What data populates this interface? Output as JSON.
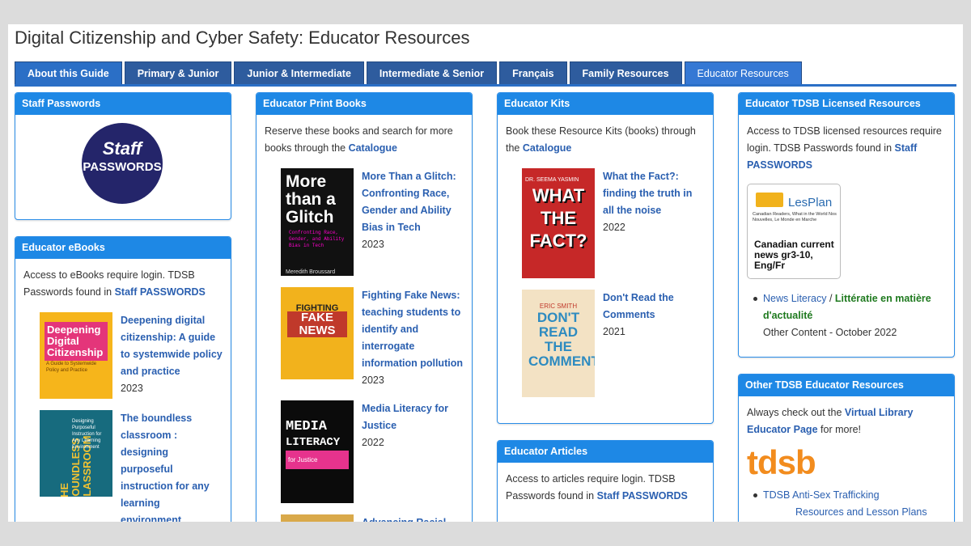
{
  "page_title": "Digital Citizenship and Cyber Safety: Educator Resources",
  "tabs": [
    "About this Guide",
    "Primary & Junior",
    "Junior & Intermediate",
    "Intermediate & Senior",
    "Français",
    "Family Resources",
    "Educator Resources"
  ],
  "staff_passwords": {
    "heading": "Staff Passwords",
    "logo_line1": "Staff",
    "logo_line2": "PASSWORDS"
  },
  "ebooks": {
    "heading": "Educator eBooks",
    "intro": "Access to eBooks require login. TDSB Passwords found in",
    "intro_link": "Staff PASSWORDS",
    "books": [
      {
        "title": "Deepening digital citizenship: A guide to systemwide policy and practice",
        "year": "2023",
        "cover": "Deepening Digital Citizenship",
        "cover_sub": "A Guide to Systemwide Policy and Practice"
      },
      {
        "title": "The boundless classroom : designing purposeful instruction for any learning environment",
        "year": "2023",
        "cover": "THE BOUNDLESS CLASSROOM",
        "cover_sub": "Designing Purposeful Instruction for Any Learning Environment"
      }
    ]
  },
  "print_books": {
    "heading": "Educator Print Books",
    "intro": "Reserve these books and search for more books through the",
    "intro_link": "Catalogue",
    "books": [
      {
        "title": "More Than a Glitch: Confronting Race, Gender and Ability Bias in Tech",
        "year": "2023",
        "cover": "More than a Glitch",
        "cover_sub": "Confronting Race, Gender, and Ability Bias in Tech",
        "author": "Meredith Broussard"
      },
      {
        "title": "Fighting Fake News: teaching students to identify and interrogate information pollution",
        "year": "2023",
        "cover_l1": "FIGHTING",
        "cover_l2": "FAKE NEWS"
      },
      {
        "title": "Media Literacy for Justice",
        "year": "2022",
        "cover_l1": "MEDIA",
        "cover_l2": "LITERACY",
        "cover_l3": "for Justice"
      },
      {
        "title": "Advancing Racial"
      }
    ]
  },
  "kits": {
    "heading": "Educator Kits",
    "intro": "Book these Resource Kits (books) through the",
    "intro_link": "Catalogue",
    "books": [
      {
        "title": "What the Fact?: finding the truth in all the noise",
        "year": "2022",
        "cover_author": "DR. SEEMA YASMIN",
        "cover": "WHAT THE FACT?"
      },
      {
        "title": "Don't Read the Comments",
        "year": "2021",
        "cover_author": "ERIC SMITH",
        "cover": "DON'T READ THE COMMENTS"
      }
    ]
  },
  "articles": {
    "heading": "Educator Articles",
    "intro": "Access to articles require login. TDSB Passwords found in",
    "intro_link": "Staff PASSWORDS"
  },
  "licensed": {
    "heading": "Educator TDSB Licensed Resources",
    "intro": "Access to TDSB licensed resources require login. TDSB Passwords found in",
    "intro_link": "Staff PASSWORDS",
    "lesplan_brand": "LesPlan",
    "lesplan_tag": "Canadian Readers, What in the World Nos Nouvelles, Le Monde en Marche",
    "lesplan_caption": "Canadian current news gr3-10, Eng/Fr",
    "item_link": "News Literacy",
    "item_sep": " / ",
    "item_fr": "Littératie en matière d'actualité",
    "item_note": "Other Content - October 2022"
  },
  "other": {
    "heading": "Other TDSB Educator Resources",
    "intro": "Always check out the",
    "intro_link": "Virtual Library Educator Page",
    "intro_tail": "for more!",
    "logo": "tdsb",
    "item1": "TDSB Anti-Sex Trafficking",
    "item1_cont": "Resources and Lesson Plans"
  },
  "colors": {
    "header": "#1e88e5",
    "tab": "#2e5c9e",
    "link": "#2a5fb0"
  }
}
